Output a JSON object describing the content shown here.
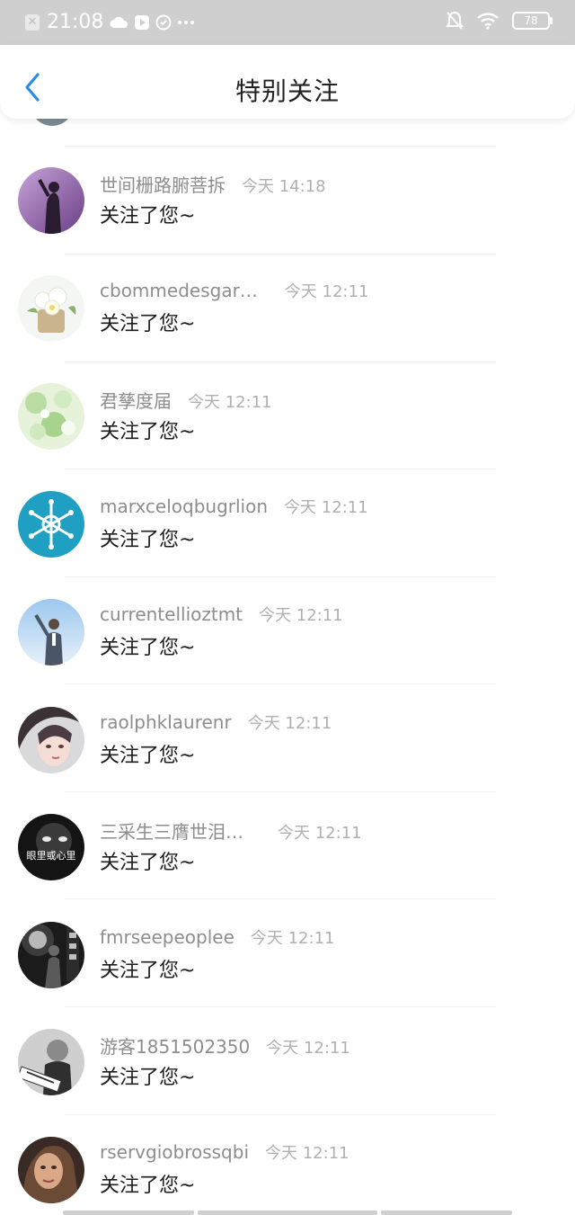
{
  "status_bar": {
    "time": "21:08",
    "battery": "78",
    "icons_left": [
      "notification-x-icon",
      "cloud-icon",
      "play-icon",
      "sync-icon",
      "more-dots-icon"
    ],
    "icons_right": [
      "bell-off-icon",
      "wifi-icon",
      "battery-icon"
    ]
  },
  "header": {
    "title": "特别关注",
    "back_icon": "chevron-left-icon",
    "accent": "#2b8ce3"
  },
  "list": {
    "items": [
      {
        "name": "世间栅路腑菩拆",
        "time": "今天 14:18",
        "message": "关注了您~",
        "avatar": "purple-silhouette"
      },
      {
        "name": "cbommedesgar…",
        "time": "今天 12:11",
        "message": "关注了您~",
        "avatar": "white-flowers-basket"
      },
      {
        "name": "君孳度届",
        "time": "今天 12:11",
        "message": "关注了您~",
        "avatar": "green-floral"
      },
      {
        "name": "marxceloqbugrlion",
        "time": "今天 12:11",
        "message": "关注了您~",
        "avatar": "blue-snowflake"
      },
      {
        "name": "currentellioztmt",
        "time": "今天 12:11",
        "message": "关注了您~",
        "avatar": "man-in-suit-sky"
      },
      {
        "name": "raolphklaurenr",
        "time": "今天 12:11",
        "message": "关注了您~",
        "avatar": "anime-girl-portrait"
      },
      {
        "name": "三采生三膺世泪…",
        "time": "今天 12:11",
        "message": "关注了您~",
        "avatar": "dark-face-text",
        "avatar_text": "眼里或心里"
      },
      {
        "name": "fmrseepeoplee",
        "time": "今天 12:11",
        "message": "关注了您~",
        "avatar": "night-street-bw"
      },
      {
        "name": "游客1851502350",
        "time": "今天 12:11",
        "message": "关注了您~",
        "avatar": "man-with-sign"
      },
      {
        "name": "rservgiobrossqbi",
        "time": "今天 12:11",
        "message": "关注了您~",
        "avatar": "woman-portrait"
      }
    ]
  }
}
